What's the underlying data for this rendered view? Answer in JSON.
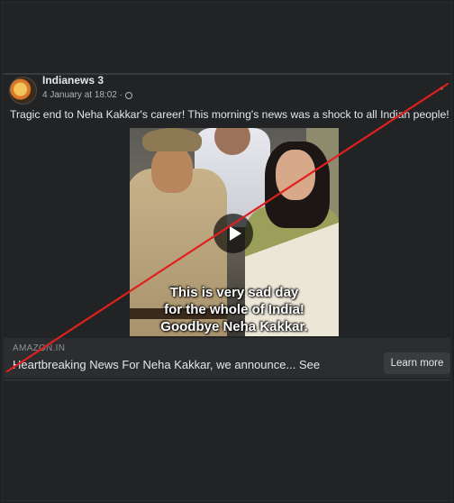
{
  "post": {
    "page_name": "Indianews 3",
    "timestamp": "4 January at 18:02 ·",
    "text": "Tragic end to Neha Kakkar's career! This morning's news was a shock to all Indian people!"
  },
  "video": {
    "caption_lines": [
      "This is very sad day",
      "for the whole of India!",
      "Goodbye Neha Kakkar."
    ]
  },
  "ad": {
    "source": "AMAZON.IN",
    "headline": "Heartbreaking News For Neha Kakkar, we announce... See",
    "cta_label": "Learn more"
  },
  "colors": {
    "strike_line": "#e0201f",
    "background": "#222324"
  },
  "icons": [
    "globe-icon",
    "more-icon",
    "play-icon"
  ]
}
